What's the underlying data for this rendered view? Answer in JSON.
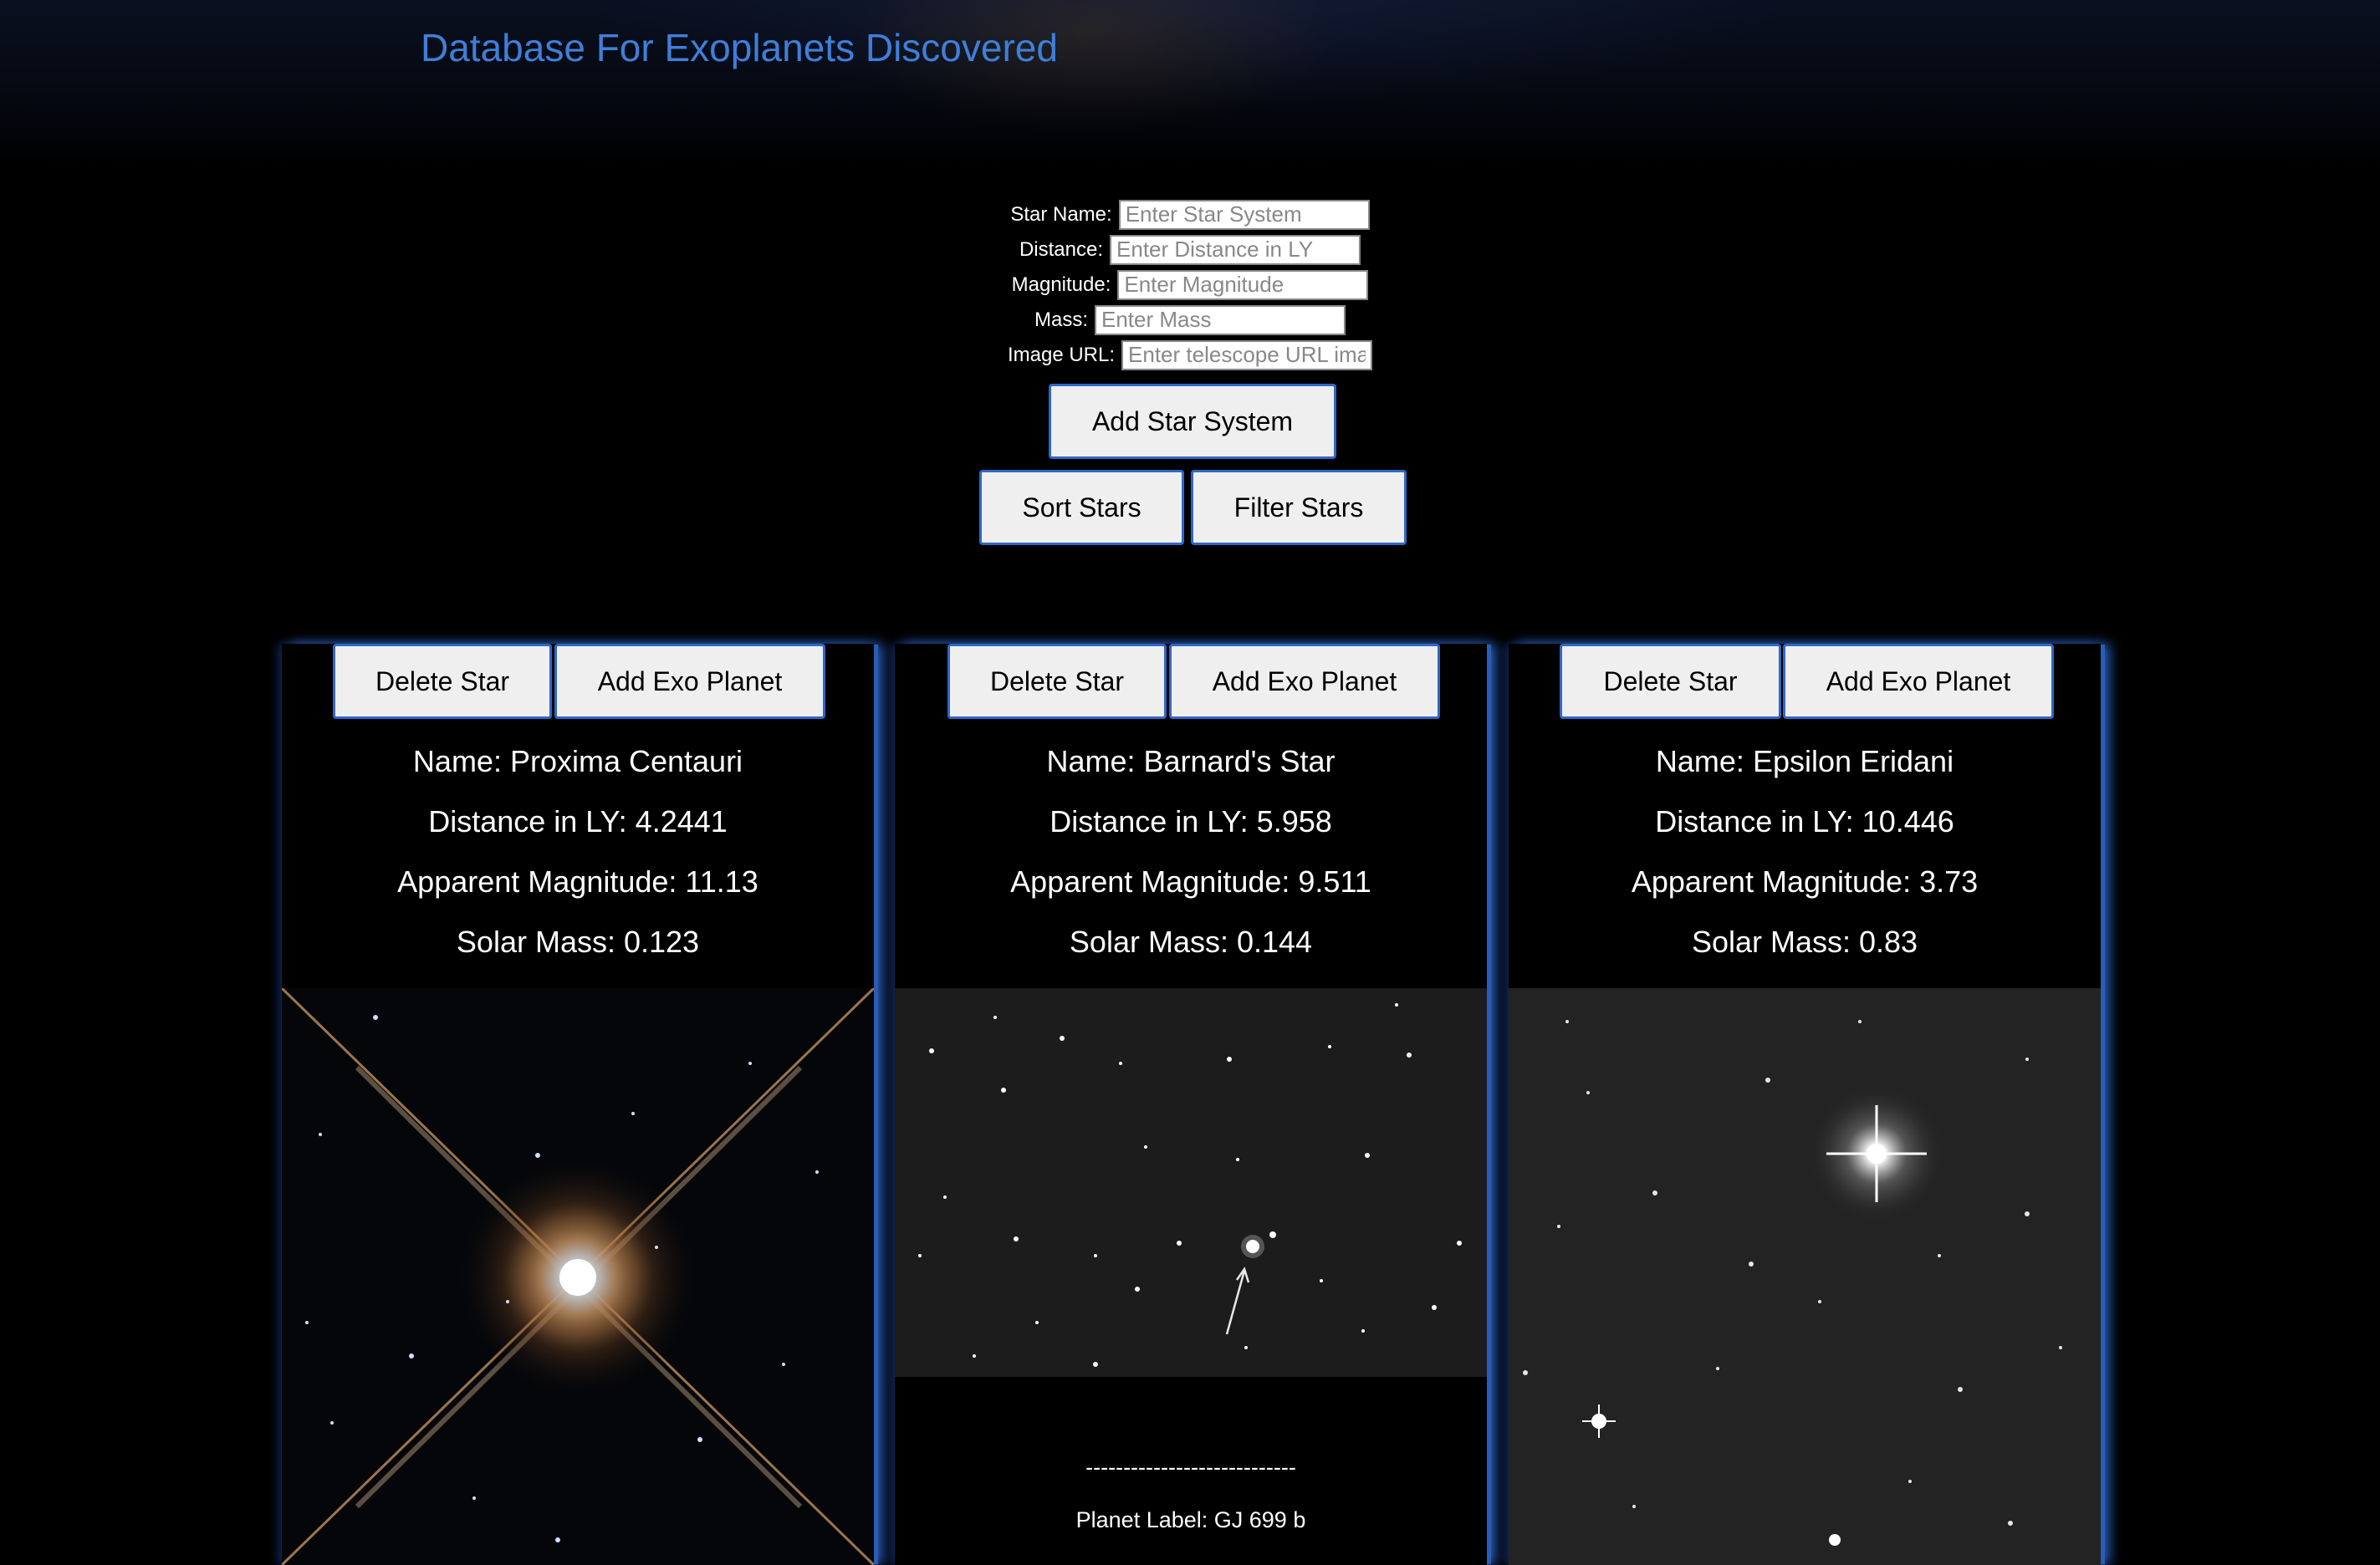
{
  "page": {
    "title": "Database For Exoplanets Discovered"
  },
  "form": {
    "fields": [
      {
        "label": "Star Name:",
        "placeholder": "Enter Star System"
      },
      {
        "label": "Distance:",
        "placeholder": "Enter Distance in LY"
      },
      {
        "label": "Magnitude:",
        "placeholder": "Enter Magnitude"
      },
      {
        "label": "Mass:",
        "placeholder": "Enter Mass"
      },
      {
        "label": "Image URL:",
        "placeholder": "Enter telescope URL ima"
      }
    ],
    "add_button": "Add Star System",
    "sort_button": "Sort Stars",
    "filter_button": "Filter Stars"
  },
  "cards": [
    {
      "delete_label": "Delete Star",
      "add_planet_label": "Add Exo Planet",
      "name": "Name: Proxima Centauri",
      "distance": "Distance in LY: 4.2441",
      "magnitude": "Apparent Magnitude: 11.13",
      "mass": "Solar Mass: 0.123",
      "image": "proxima-centauri-telescope-photo"
    },
    {
      "delete_label": "Delete Star",
      "add_planet_label": "Add Exo Planet",
      "name": "Name: Barnard's Star",
      "distance": "Distance in LY: 5.958",
      "magnitude": "Apparent Magnitude: 9.511",
      "mass": "Solar Mass: 0.144",
      "image": "barnards-star-telescope-photo",
      "divider": "----------------------------",
      "planet_label": "Planet Label: GJ 699 b"
    },
    {
      "delete_label": "Delete Star",
      "add_planet_label": "Add Exo Planet",
      "name": "Name: Epsilon Eridani",
      "distance": "Distance in LY: 10.446",
      "magnitude": "Apparent Magnitude: 3.73",
      "mass": "Solar Mass: 0.83",
      "image": "epsilon-eridani-telescope-photo"
    }
  ],
  "colors": {
    "title": "#3f7fd8",
    "button_border": "#2f68c8",
    "card_glow": "#2a5db5"
  }
}
